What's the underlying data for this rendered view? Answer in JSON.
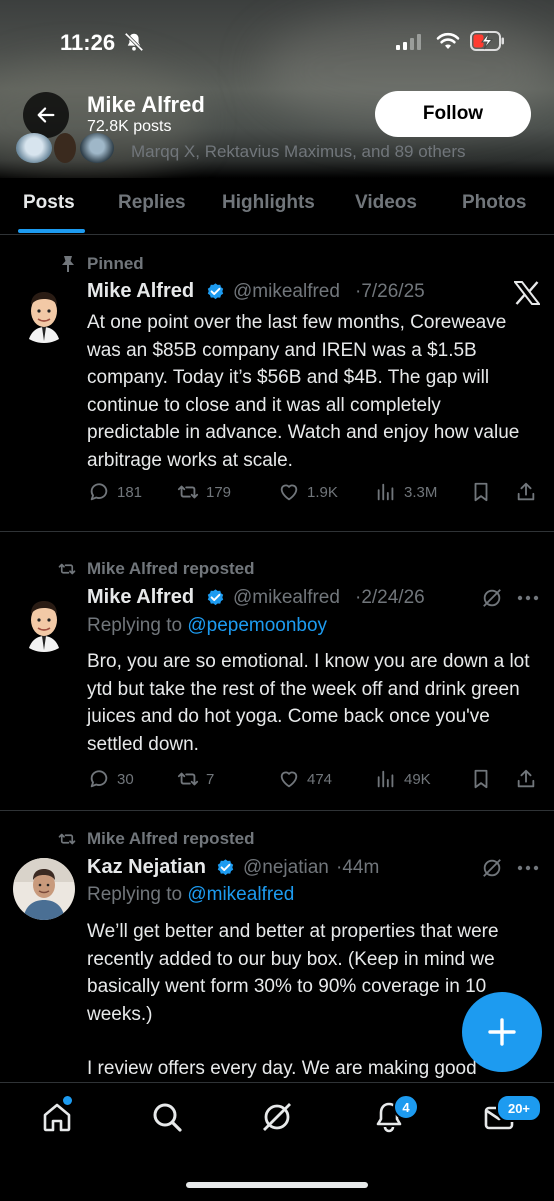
{
  "status_bar": {
    "time": "11:26"
  },
  "header": {
    "name": "Mike Alfred",
    "posts_count": "72.8K posts",
    "follow_label": "Follow",
    "followers_you_know": "Marqq X, Rektavius Maximus, and 89 others"
  },
  "tabs": [
    "Posts",
    "Replies",
    "Highlights",
    "Videos",
    "Photos"
  ],
  "posts": [
    {
      "context": "Pinned",
      "name": "Mike Alfred",
      "handle": "@mikealfred",
      "date": "·7/26/25",
      "text": "At one point over the last few months, Coreweave was an $85B company and IREN was a $1.5B company. Today it’s $56B and $4B. The gap will continue to close and it was all completely predictable in advance. Watch and enjoy how value arbitrage works at scale.",
      "replies": "181",
      "reposts": "179",
      "likes": "1.9K",
      "views": "3.3M"
    },
    {
      "context": "Mike Alfred reposted",
      "name": "Mike Alfred",
      "handle": "@mikealfred",
      "date": "·2/24/26",
      "replying_prefix": "Replying to",
      "replying_to": "@pepemoonboy",
      "text": "Bro, you are so emotional. I know you are down a lot ytd but take the rest of the week off and drink green juices and do hot yoga. Come back once you've settled down.",
      "replies": "30",
      "reposts": "7",
      "likes": "474",
      "views": "49K"
    },
    {
      "context": "Mike Alfred reposted",
      "name": "Kaz Nejatian",
      "handle": "@nejatian",
      "date": "·44m",
      "replying_prefix": "Replying to",
      "replying_to": "@mikealfred",
      "text_p1": "We’ll get better and better at properties that were recently added to our buy box. (Keep in mind we basically went form 30% to 90% coverage in 10 weeks.)",
      "text_p2": "I review offers every day. We are making good"
    }
  ],
  "nav": {
    "notifications_badge": "4",
    "messages_badge": "20+"
  },
  "colors": {
    "accent": "#1d9bf0",
    "background": "#000000",
    "secondary_text": "#71767b"
  }
}
